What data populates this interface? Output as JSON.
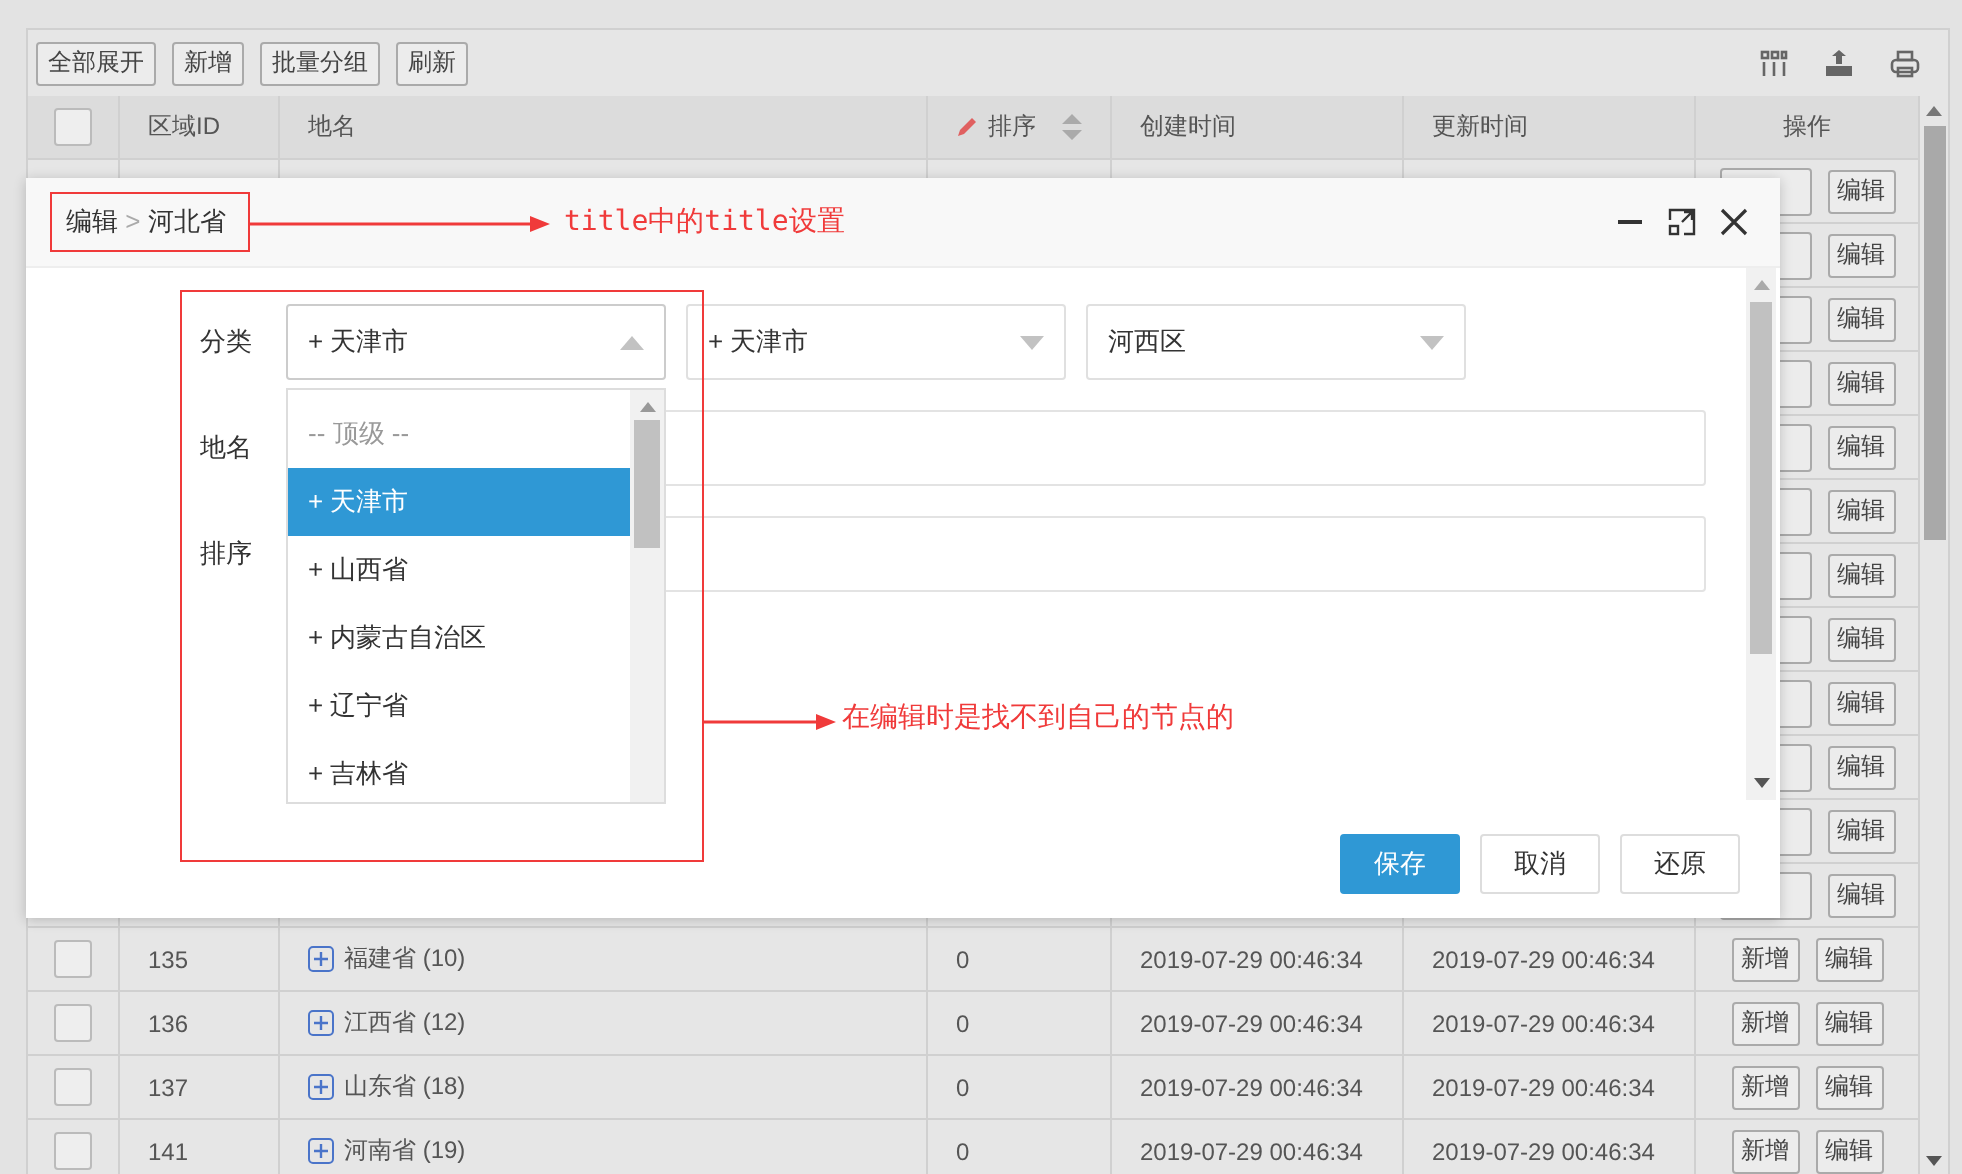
{
  "toolbar": {
    "buttons": [
      "全部展开",
      "新增",
      "批量分组",
      "刷新"
    ]
  },
  "table": {
    "columns": [
      {
        "kind": "checkbox",
        "checked": false
      },
      {
        "label": "区域ID",
        "kind": "text"
      },
      {
        "label": "地名",
        "kind": "text"
      },
      {
        "label": "排序",
        "kind": "sortable"
      },
      {
        "label": "创建时间",
        "kind": "text"
      },
      {
        "label": "更新时间",
        "kind": "text"
      },
      {
        "label": "操作",
        "kind": "center"
      }
    ],
    "covered_rows": [
      {
        "actions": [
          "编辑"
        ]
      },
      {
        "actions": [
          "编辑"
        ]
      },
      {
        "actions": [
          "编辑"
        ]
      },
      {
        "actions": [
          "编辑"
        ]
      },
      {
        "actions": [
          "编辑"
        ]
      },
      {
        "actions": [
          "编辑"
        ]
      },
      {
        "actions": [
          "编辑"
        ]
      },
      {
        "actions": [
          "编辑"
        ]
      },
      {
        "actions": [
          "编辑"
        ]
      },
      {
        "actions": [
          "编辑"
        ]
      },
      {
        "actions": [
          "编辑"
        ]
      },
      {
        "actions": [
          "编辑"
        ]
      }
    ],
    "rows": [
      {
        "checked": false,
        "id": "135",
        "name": "福建省 (10)",
        "sort": "0",
        "created": "2019-07-29 00:46:34",
        "updated": "2019-07-29 00:46:34",
        "actions": [
          "新增",
          "编辑"
        ]
      },
      {
        "checked": false,
        "id": "136",
        "name": "江西省 (12)",
        "sort": "0",
        "created": "2019-07-29 00:46:34",
        "updated": "2019-07-29 00:46:34",
        "actions": [
          "新增",
          "编辑"
        ]
      },
      {
        "checked": false,
        "id": "137",
        "name": "山东省 (18)",
        "sort": "0",
        "created": "2019-07-29 00:46:34",
        "updated": "2019-07-29 00:46:34",
        "actions": [
          "新增",
          "编辑"
        ]
      },
      {
        "checked": false,
        "id": "141",
        "name": "河南省 (19)",
        "sort": "0",
        "created": "2019-07-29 00:46:34",
        "updated": "2019-07-29 00:46:34",
        "actions": [
          "新增",
          "编辑"
        ]
      }
    ]
  },
  "modal": {
    "breadcrumb": {
      "parent": "编辑",
      "separator": ">",
      "current": "河北省"
    },
    "fields": [
      {
        "label": "分类",
        "kind": "selects",
        "selects": [
          {
            "value": "+ 天津市",
            "expanded": true
          },
          {
            "value": "+ 天津市",
            "expanded": false
          },
          {
            "value": "河西区",
            "expanded": false
          }
        ]
      },
      {
        "label": "地名",
        "kind": "input"
      },
      {
        "label": "排序",
        "kind": "input"
      }
    ],
    "dropdown": {
      "options": [
        {
          "label": "-- 顶级 --",
          "kind": "placeholder",
          "selected": false
        },
        {
          "label": "+ 天津市",
          "kind": "option",
          "selected": true
        },
        {
          "label": "+ 山西省",
          "kind": "option",
          "selected": false
        },
        {
          "label": "+ 内蒙古自治区",
          "kind": "option",
          "selected": false
        },
        {
          "label": "+ 辽宁省",
          "kind": "option",
          "selected": false
        },
        {
          "label": "+ 吉林省",
          "kind": "option",
          "selected": false
        }
      ]
    },
    "buttons": [
      {
        "label": "保存",
        "kind": "primary"
      },
      {
        "label": "取消",
        "kind": "default"
      },
      {
        "label": "还原",
        "kind": "default"
      }
    ]
  },
  "annotations": [
    {
      "text": "title中的title设置"
    },
    {
      "text": "在编辑时是找不到自己的节点的"
    }
  ]
}
